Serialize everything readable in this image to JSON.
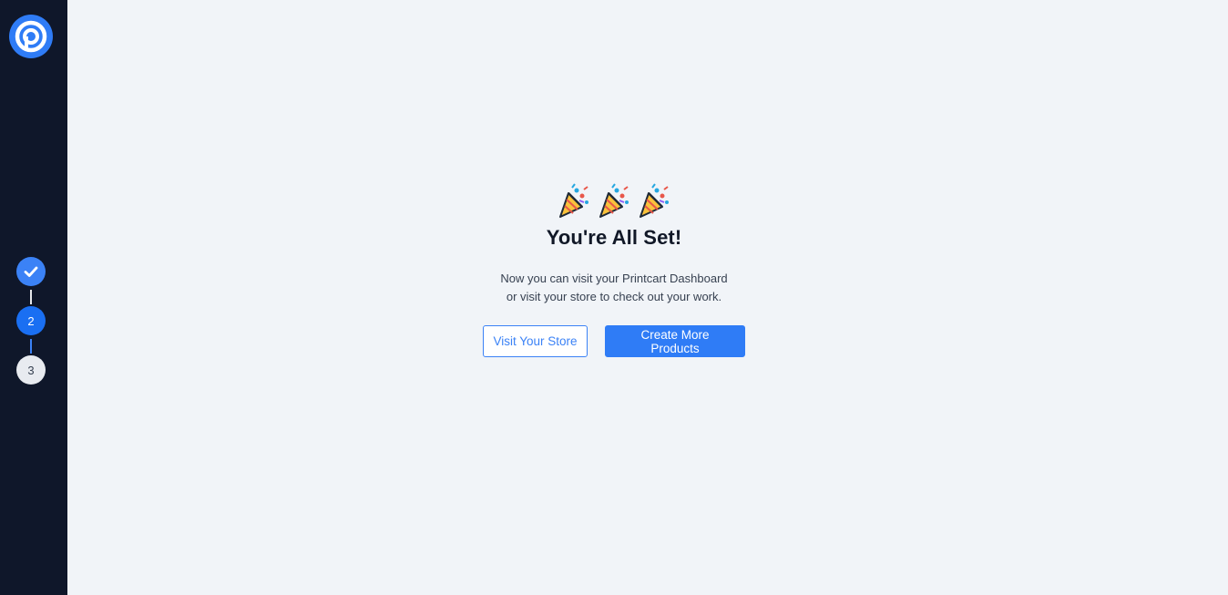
{
  "colors": {
    "sidebar_bg": "#0f172a",
    "page_bg": "#f1f4f8",
    "accent": "#2f7cf6",
    "step_inactive": "#e8ebf0"
  },
  "sidebar": {
    "logo_icon": "printcart-logo-icon",
    "steps": [
      {
        "label": "",
        "state": "completed",
        "icon": "check-icon"
      },
      {
        "label": "2",
        "state": "current"
      },
      {
        "label": "3",
        "state": "upcoming"
      }
    ]
  },
  "main": {
    "emoji_icon": "party-popper-icon",
    "title": "You're All Set!",
    "description_line1": "Now you can visit your Printcart Dashboard",
    "description_line2": "or visit your store to check out your work.",
    "buttons": {
      "visit_store": "Visit Your Store",
      "create_products": "Create More Products"
    }
  }
}
